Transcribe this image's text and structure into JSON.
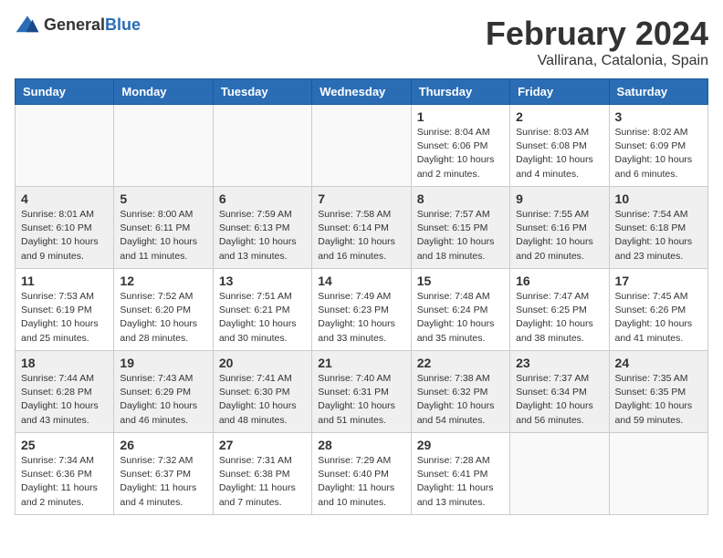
{
  "header": {
    "logo_general": "General",
    "logo_blue": "Blue",
    "month_year": "February 2024",
    "location": "Vallirana, Catalonia, Spain"
  },
  "days_of_week": [
    "Sunday",
    "Monday",
    "Tuesday",
    "Wednesday",
    "Thursday",
    "Friday",
    "Saturday"
  ],
  "weeks": [
    [
      {
        "day": "",
        "info": ""
      },
      {
        "day": "",
        "info": ""
      },
      {
        "day": "",
        "info": ""
      },
      {
        "day": "",
        "info": ""
      },
      {
        "day": "1",
        "info": "Sunrise: 8:04 AM\nSunset: 6:06 PM\nDaylight: 10 hours\nand 2 minutes."
      },
      {
        "day": "2",
        "info": "Sunrise: 8:03 AM\nSunset: 6:08 PM\nDaylight: 10 hours\nand 4 minutes."
      },
      {
        "day": "3",
        "info": "Sunrise: 8:02 AM\nSunset: 6:09 PM\nDaylight: 10 hours\nand 6 minutes."
      }
    ],
    [
      {
        "day": "4",
        "info": "Sunrise: 8:01 AM\nSunset: 6:10 PM\nDaylight: 10 hours\nand 9 minutes."
      },
      {
        "day": "5",
        "info": "Sunrise: 8:00 AM\nSunset: 6:11 PM\nDaylight: 10 hours\nand 11 minutes."
      },
      {
        "day": "6",
        "info": "Sunrise: 7:59 AM\nSunset: 6:13 PM\nDaylight: 10 hours\nand 13 minutes."
      },
      {
        "day": "7",
        "info": "Sunrise: 7:58 AM\nSunset: 6:14 PM\nDaylight: 10 hours\nand 16 minutes."
      },
      {
        "day": "8",
        "info": "Sunrise: 7:57 AM\nSunset: 6:15 PM\nDaylight: 10 hours\nand 18 minutes."
      },
      {
        "day": "9",
        "info": "Sunrise: 7:55 AM\nSunset: 6:16 PM\nDaylight: 10 hours\nand 20 minutes."
      },
      {
        "day": "10",
        "info": "Sunrise: 7:54 AM\nSunset: 6:18 PM\nDaylight: 10 hours\nand 23 minutes."
      }
    ],
    [
      {
        "day": "11",
        "info": "Sunrise: 7:53 AM\nSunset: 6:19 PM\nDaylight: 10 hours\nand 25 minutes."
      },
      {
        "day": "12",
        "info": "Sunrise: 7:52 AM\nSunset: 6:20 PM\nDaylight: 10 hours\nand 28 minutes."
      },
      {
        "day": "13",
        "info": "Sunrise: 7:51 AM\nSunset: 6:21 PM\nDaylight: 10 hours\nand 30 minutes."
      },
      {
        "day": "14",
        "info": "Sunrise: 7:49 AM\nSunset: 6:23 PM\nDaylight: 10 hours\nand 33 minutes."
      },
      {
        "day": "15",
        "info": "Sunrise: 7:48 AM\nSunset: 6:24 PM\nDaylight: 10 hours\nand 35 minutes."
      },
      {
        "day": "16",
        "info": "Sunrise: 7:47 AM\nSunset: 6:25 PM\nDaylight: 10 hours\nand 38 minutes."
      },
      {
        "day": "17",
        "info": "Sunrise: 7:45 AM\nSunset: 6:26 PM\nDaylight: 10 hours\nand 41 minutes."
      }
    ],
    [
      {
        "day": "18",
        "info": "Sunrise: 7:44 AM\nSunset: 6:28 PM\nDaylight: 10 hours\nand 43 minutes."
      },
      {
        "day": "19",
        "info": "Sunrise: 7:43 AM\nSunset: 6:29 PM\nDaylight: 10 hours\nand 46 minutes."
      },
      {
        "day": "20",
        "info": "Sunrise: 7:41 AM\nSunset: 6:30 PM\nDaylight: 10 hours\nand 48 minutes."
      },
      {
        "day": "21",
        "info": "Sunrise: 7:40 AM\nSunset: 6:31 PM\nDaylight: 10 hours\nand 51 minutes."
      },
      {
        "day": "22",
        "info": "Sunrise: 7:38 AM\nSunset: 6:32 PM\nDaylight: 10 hours\nand 54 minutes."
      },
      {
        "day": "23",
        "info": "Sunrise: 7:37 AM\nSunset: 6:34 PM\nDaylight: 10 hours\nand 56 minutes."
      },
      {
        "day": "24",
        "info": "Sunrise: 7:35 AM\nSunset: 6:35 PM\nDaylight: 10 hours\nand 59 minutes."
      }
    ],
    [
      {
        "day": "25",
        "info": "Sunrise: 7:34 AM\nSunset: 6:36 PM\nDaylight: 11 hours\nand 2 minutes."
      },
      {
        "day": "26",
        "info": "Sunrise: 7:32 AM\nSunset: 6:37 PM\nDaylight: 11 hours\nand 4 minutes."
      },
      {
        "day": "27",
        "info": "Sunrise: 7:31 AM\nSunset: 6:38 PM\nDaylight: 11 hours\nand 7 minutes."
      },
      {
        "day": "28",
        "info": "Sunrise: 7:29 AM\nSunset: 6:40 PM\nDaylight: 11 hours\nand 10 minutes."
      },
      {
        "day": "29",
        "info": "Sunrise: 7:28 AM\nSunset: 6:41 PM\nDaylight: 11 hours\nand 13 minutes."
      },
      {
        "day": "",
        "info": ""
      },
      {
        "day": "",
        "info": ""
      }
    ]
  ]
}
